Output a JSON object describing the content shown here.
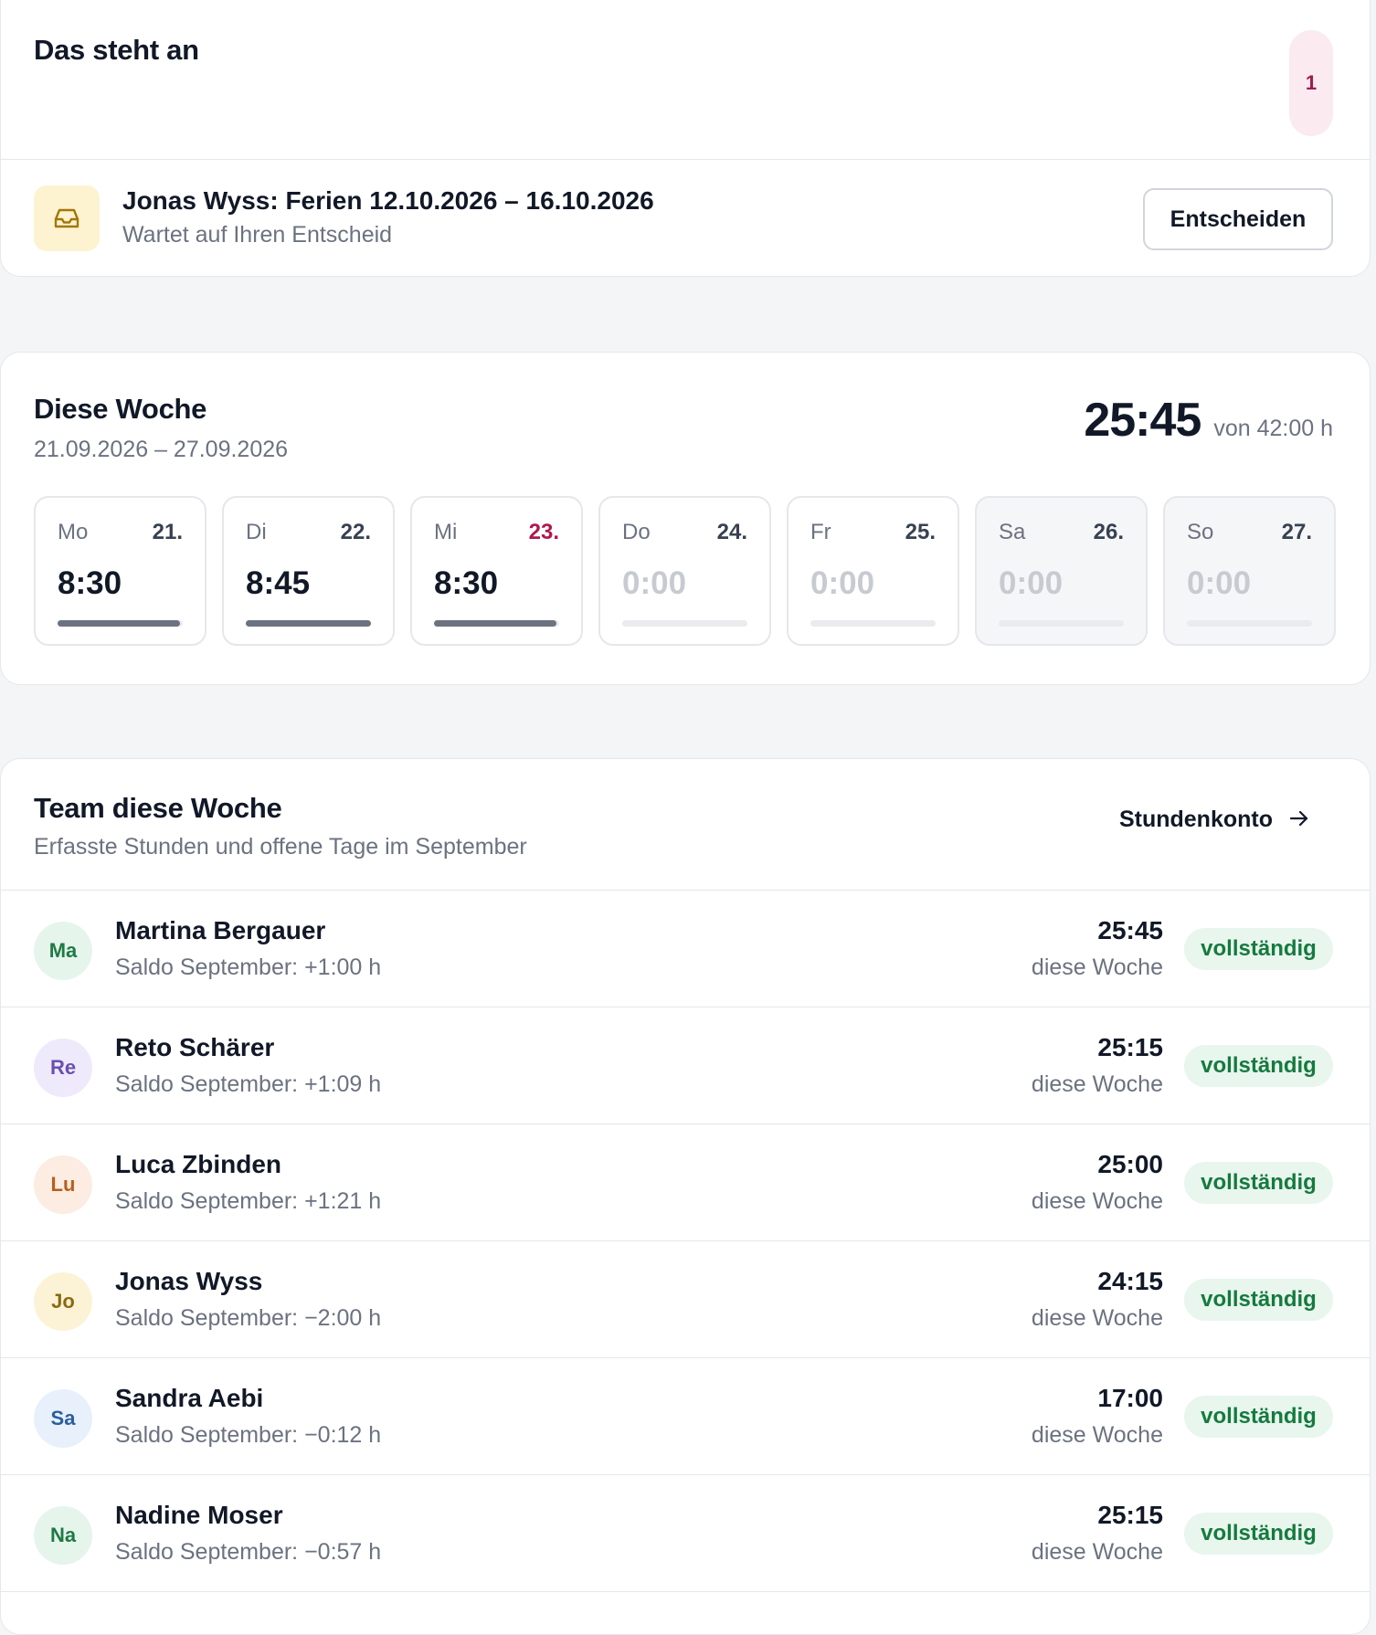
{
  "pending": {
    "title": "Das steht an",
    "count": "1",
    "request": {
      "title": "Jonas Wyss: Ferien 12.10.2026 – 16.10.2026",
      "subtitle": "Wartet auf Ihren Entscheid",
      "icon": "inbox-icon",
      "button_label": "Entscheiden"
    }
  },
  "week": {
    "title": "Diese Woche",
    "range": "21.09.2026 – 27.09.2026",
    "total": "25:45",
    "target": "von 42:00 h",
    "days": [
      {
        "name": "Mo",
        "date": "21.",
        "hours": "8:30",
        "fill": 0.98,
        "today": false,
        "weekend": false
      },
      {
        "name": "Di",
        "date": "22.",
        "hours": "8:45",
        "fill": 1.0,
        "today": false,
        "weekend": false
      },
      {
        "name": "Mi",
        "date": "23.",
        "hours": "8:30",
        "fill": 0.98,
        "today": true,
        "weekend": false
      },
      {
        "name": "Do",
        "date": "24.",
        "hours": "0:00",
        "fill": 0,
        "today": false,
        "weekend": false
      },
      {
        "name": "Fr",
        "date": "25.",
        "hours": "0:00",
        "fill": 0,
        "today": false,
        "weekend": false
      },
      {
        "name": "Sa",
        "date": "26.",
        "hours": "0:00",
        "fill": 0,
        "today": false,
        "weekend": true
      },
      {
        "name": "So",
        "date": "27.",
        "hours": "0:00",
        "fill": 0,
        "today": false,
        "weekend": true
      }
    ]
  },
  "team": {
    "title": "Team diese Woche",
    "subtitle": "Erfasste Stunden und offene Tage im September",
    "link_label": "Stundenkonto",
    "link_icon": "arrow-right-icon",
    "members": [
      {
        "initials": "Ma",
        "name": "Martina Bergauer",
        "saldo": "Saldo September: +1:00 h",
        "hours": "25:45",
        "hours_label": "diese Woche",
        "status": "vollständig",
        "avatar_bg": "#e6f5ec",
        "avatar_fg": "#1f7a45"
      },
      {
        "initials": "Re",
        "name": "Reto Schärer",
        "saldo": "Saldo September: +1:09 h",
        "hours": "25:15",
        "hours_label": "diese Woche",
        "status": "vollständig",
        "avatar_bg": "#efeafb",
        "avatar_fg": "#6b4fb0"
      },
      {
        "initials": "Lu",
        "name": "Luca Zbinden",
        "saldo": "Saldo September: +1:21 h",
        "hours": "25:00",
        "hours_label": "diese Woche",
        "status": "vollständig",
        "avatar_bg": "#fcece2",
        "avatar_fg": "#b85e1c"
      },
      {
        "initials": "Jo",
        "name": "Jonas Wyss",
        "saldo": "Saldo September: −2:00 h",
        "hours": "24:15",
        "hours_label": "diese Woche",
        "status": "vollständig",
        "avatar_bg": "#fcf3d6",
        "avatar_fg": "#8a6a12"
      },
      {
        "initials": "Sa",
        "name": "Sandra Aebi",
        "saldo": "Saldo September: −0:12 h",
        "hours": "17:00",
        "hours_label": "diese Woche",
        "status": "vollständig",
        "avatar_bg": "#e7f0fb",
        "avatar_fg": "#2b5f9e"
      },
      {
        "initials": "Na",
        "name": "Nadine Moser",
        "saldo": "Saldo September: −0:57 h",
        "hours": "25:15",
        "hours_label": "diese Woche",
        "status": "vollständig",
        "avatar_bg": "#e6f5ec",
        "avatar_fg": "#1f7a45"
      }
    ]
  }
}
